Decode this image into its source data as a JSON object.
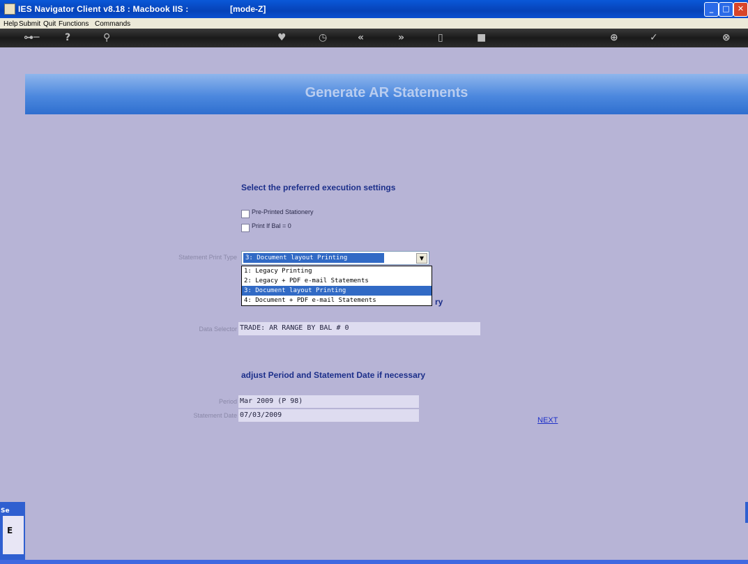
{
  "window": {
    "title": "IES Navigator Client v8.18 : Macbook IIS :",
    "mode": "[mode-Z]",
    "min_icon": "minimize-icon",
    "max_icon": "maximize-icon",
    "close_icon": "close-icon"
  },
  "menu": {
    "items": [
      "Help",
      "Submit",
      "Quit",
      "Functions",
      "Commands"
    ]
  },
  "toolbar": {
    "icons": [
      "key-icon",
      "help-icon",
      "search-icon",
      "heart-icon",
      "clock-icon",
      "back-icon",
      "forward-icon",
      "trash-icon",
      "stop-icon",
      "add-icon",
      "check-icon",
      "close-icon"
    ]
  },
  "page": {
    "title": "Generate AR Statements"
  },
  "settings": {
    "heading": "Select the preferred execution settings",
    "options": [
      {
        "label": "Pre-Printed Stationery",
        "checked": false
      },
      {
        "label": "Print If Bal = 0",
        "checked": false
      }
    ]
  },
  "print_type": {
    "label": "Statement Print Type",
    "selected": "3: Document layout Printing",
    "options": [
      "1: Legacy Printing",
      "2: Legacy + PDF e-mail Statements",
      "3: Document layout Printing",
      "4: Document + PDF e-mail Statements"
    ],
    "obscured_heading_tail": "ry"
  },
  "data_selector": {
    "label": "Data Selector",
    "value": "TRADE: AR RANGE BY BAL # 0"
  },
  "period_section": {
    "heading": "adjust Period and Statement Date if necessary",
    "period_label": "Period",
    "period_value": "Mar 2009 (P 98)",
    "date_label": "Statement Date",
    "date_value": "07/03/2009"
  },
  "next_link": "NEXT",
  "left_panel": {
    "label": "Se",
    "glyph": "E"
  }
}
